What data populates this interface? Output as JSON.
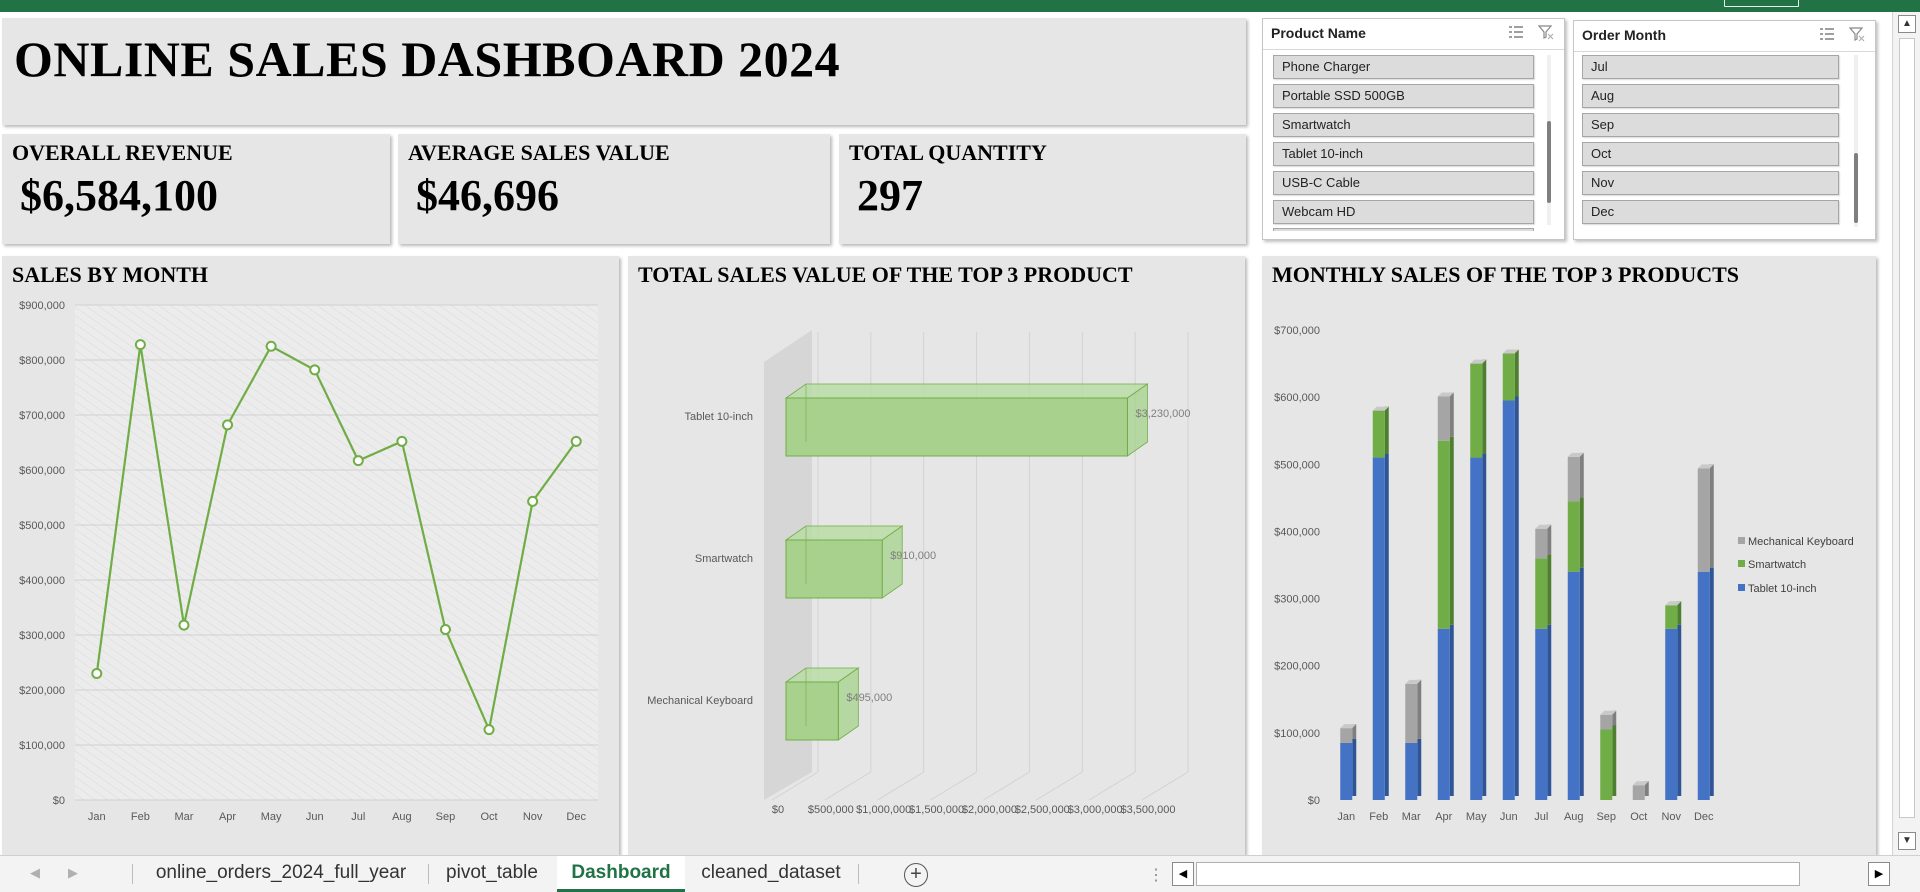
{
  "dashboard": {
    "title": "ONLINE SALES DASHBOARD 2024",
    "kpis": [
      {
        "label": "OVERALL REVENUE",
        "value": "$6,584,100"
      },
      {
        "label": "AVERAGE SALES VALUE",
        "value": "$46,696"
      },
      {
        "label": "TOTAL QUANTITY",
        "value": "297"
      }
    ]
  },
  "slicers": {
    "product": {
      "header": "Product Name",
      "items": [
        "Phone Charger",
        "Portable SSD 500GB",
        "Smartwatch",
        "Tablet 10-inch",
        "USB-C Cable",
        "Webcam HD"
      ]
    },
    "month": {
      "header": "Order Month",
      "items": [
        "Jul",
        "Aug",
        "Sep",
        "Oct",
        "Nov",
        "Dec"
      ]
    }
  },
  "sheet_tabs": [
    "online_orders_2024_full_year",
    "pivot_table",
    "Dashboard",
    "cleaned_dataset"
  ],
  "active_tab": "Dashboard",
  "colors": {
    "accent": "#217346",
    "panel": "#e7e6e6",
    "line": "#70ad47",
    "tablet": "#4472c4",
    "smartwatch": "#70ad47",
    "keyboard": "#a5a5a5"
  },
  "chart_data": [
    {
      "type": "line",
      "title": "SALES BY MONTH",
      "categories": [
        "Jan",
        "Feb",
        "Mar",
        "Apr",
        "May",
        "Jun",
        "Jul",
        "Aug",
        "Sep",
        "Oct",
        "Nov",
        "Dec"
      ],
      "values": [
        230000,
        828000,
        318000,
        682000,
        825000,
        782000,
        617000,
        652000,
        310000,
        128000,
        543000,
        652000
      ],
      "ylim": [
        0,
        900000
      ],
      "yticks": [
        "$0",
        "$100,000",
        "$200,000",
        "$300,000",
        "$400,000",
        "$500,000",
        "$600,000",
        "$700,000",
        "$800,000",
        "$900,000"
      ],
      "grid": true
    },
    {
      "type": "bar",
      "title": "TOTAL SALES VALUE OF THE TOP 3 PRODUCT",
      "categories": [
        "Tablet 10-inch",
        "Smartwatch",
        "Mechanical Keyboard"
      ],
      "values": [
        3230000,
        910000,
        495000
      ],
      "data_labels": [
        "$3,230,000",
        "$910,000",
        "$495,000"
      ],
      "xlim": [
        0,
        3500000
      ],
      "xticks": [
        "$0",
        "$500,000",
        "$1,000,000",
        "$1,500,000",
        "$2,000,000",
        "$2,500,000",
        "$3,000,000",
        "$3,500,000"
      ]
    },
    {
      "type": "bar",
      "stacked": true,
      "title": "MONTHLY SALES OF THE TOP 3 PRODUCTS",
      "categories": [
        "Jan",
        "Feb",
        "Mar",
        "Apr",
        "May",
        "Jun",
        "Jul",
        "Aug",
        "Sep",
        "Oct",
        "Nov",
        "Dec"
      ],
      "series": [
        {
          "name": "Tablet 10-inch",
          "values": [
            85000,
            510000,
            85000,
            255000,
            510000,
            595000,
            255000,
            340000,
            0,
            0,
            255000,
            340000
          ]
        },
        {
          "name": "Smartwatch",
          "values": [
            0,
            70000,
            0,
            280000,
            140000,
            70000,
            105000,
            105000,
            105000,
            0,
            35000,
            0
          ]
        },
        {
          "name": "Mechanical Keyboard",
          "values": [
            22000,
            0,
            88000,
            66000,
            0,
            0,
            44000,
            66000,
            22000,
            22000,
            0,
            154000
          ]
        }
      ],
      "ylim": [
        0,
        700000
      ],
      "yticks": [
        "$0",
        "$100,000",
        "$200,000",
        "$300,000",
        "$400,000",
        "$500,000",
        "$600,000",
        "$700,000"
      ],
      "legend_position": "right"
    }
  ]
}
